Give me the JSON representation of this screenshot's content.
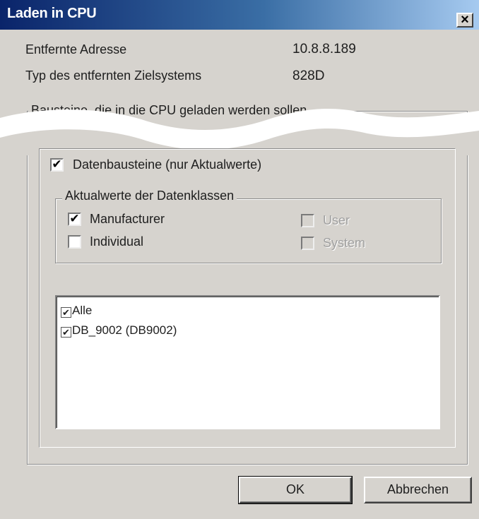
{
  "window": {
    "title": "Laden in CPU",
    "close_glyph": "×"
  },
  "info": {
    "address_label": "Entfernte Adresse",
    "address_value": "10.8.8.189",
    "target_label": "Typ des entfernten Zielsystems",
    "target_value": "828D"
  },
  "blocks_group": {
    "legend": "Bausteine, die in die CPU geladen werden sollen"
  },
  "data_blocks": {
    "label": "Datenbausteine (nur Aktualwerte)",
    "checked": true
  },
  "classes_group": {
    "legend": "Aktualwerte der Datenklassen",
    "manufacturer": {
      "label": "Manufacturer",
      "checked": true
    },
    "individual": {
      "label": "Individual",
      "checked": false
    },
    "user": {
      "label": "User",
      "checked": false,
      "enabled": false
    },
    "system": {
      "label": "System",
      "checked": false,
      "enabled": false
    }
  },
  "list": {
    "items": [
      {
        "label": "Alle",
        "checked": true
      },
      {
        "label": "DB_9002 (DB9002)",
        "checked": true
      }
    ]
  },
  "buttons": {
    "ok": "OK",
    "cancel": "Abbrechen"
  },
  "icons": {
    "close": "close-icon",
    "check": "checkmark-icon"
  },
  "colors": {
    "titlebar_start": "#0a246a",
    "titlebar_end": "#a6caf0",
    "dialog_bg": "#d6d3ce"
  }
}
